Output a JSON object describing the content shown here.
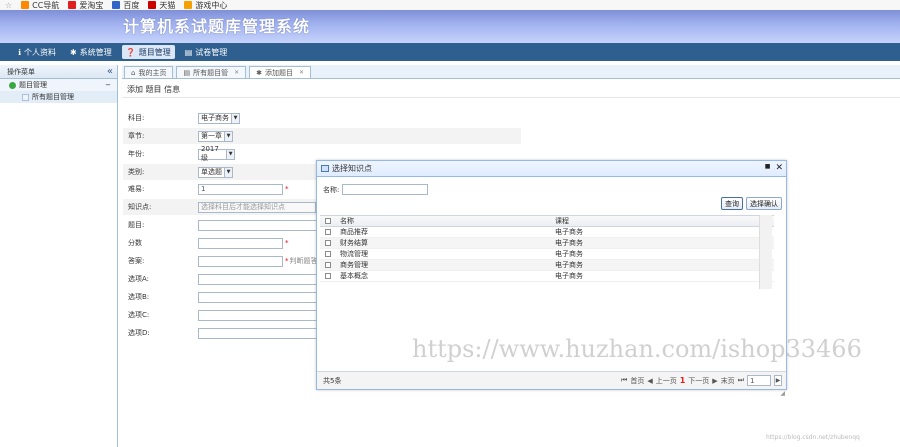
{
  "bookmarks": [
    {
      "icon": "star-icon",
      "label": "",
      "color": "#999999"
    },
    {
      "icon": "cc-nav-icon",
      "label": "CC导航",
      "color": "#ff8800"
    },
    {
      "icon": "aitaobao-icon",
      "label": "爱淘宝",
      "color": "#e02020"
    },
    {
      "icon": "baidu-icon",
      "label": "百度",
      "color": "#2f65c8"
    },
    {
      "icon": "tmall-icon",
      "label": "天猫",
      "color": "#cc0000"
    },
    {
      "icon": "game-icon",
      "label": "游戏中心",
      "color": "#f5a000"
    }
  ],
  "header": {
    "title": "计算机系试题库管理系统"
  },
  "menu": [
    {
      "icon": "info-icon",
      "label": "个人资料",
      "active": false
    },
    {
      "icon": "gear-icon",
      "label": "系统管理",
      "active": false
    },
    {
      "icon": "question-icon",
      "label": "题目管理",
      "active": true
    },
    {
      "icon": "paper-icon",
      "label": "试卷管理",
      "active": false
    }
  ],
  "left": {
    "title": "操作菜单",
    "collapse": "«",
    "group": "题目管理",
    "group_toggle": "−",
    "item": "所有题目管理"
  },
  "tabs": [
    {
      "icon": "home-icon",
      "label": "我的主页",
      "closable": false
    },
    {
      "icon": "list-icon",
      "label": "所有题目管",
      "closable": true
    },
    {
      "icon": "gear-icon",
      "label": "添加题目",
      "closable": true
    }
  ],
  "page": {
    "subtitle": "添加 题目 信息"
  },
  "form": {
    "subject_label": "科目:",
    "subject_value": "电子商务",
    "chapter_label": "章节:",
    "chapter_value": "第一章",
    "year_label": "年份:",
    "year_value": "2017级",
    "type_label": "类别:",
    "type_value": "单选题",
    "difficulty_label": "难易:",
    "difficulty_value": "1",
    "knowledge_label": "知识点:",
    "knowledge_value": "选择科目后才能选择知识点",
    "stem_label": "题目:",
    "score_label": "分数",
    "answer_label": "答案:",
    "answer_hint": "判断题答",
    "option_a_label": "选项A:",
    "option_b_label": "选项B:",
    "option_c_label": "选项C:",
    "option_d_label": "选项D:",
    "required_mark": "*"
  },
  "dialog": {
    "title": "选择知识点",
    "max": "■",
    "close": "✕",
    "search_label": "名称:",
    "btn_query": "查询",
    "btn_confirm": "选择确认",
    "columns": {
      "name": "名称",
      "course": "课程"
    },
    "rows": [
      {
        "name": "商品推荐",
        "course": "电子商务"
      },
      {
        "name": "财务结算",
        "course": "电子商务"
      },
      {
        "name": "物流管理",
        "course": "电子商务"
      },
      {
        "name": "商务管理",
        "course": "电子商务"
      },
      {
        "name": "基本概念",
        "course": "电子商务"
      }
    ],
    "total": "共5条",
    "pager": {
      "first": "首页",
      "prev": "上一页",
      "current": "1",
      "next": "下一页",
      "last": "末页",
      "page_value": "1",
      "go": "▶"
    }
  },
  "watermark": "https://www.huzhan.com/ishop33466",
  "credit": "https://blog.csdn.net/zhubenqq"
}
